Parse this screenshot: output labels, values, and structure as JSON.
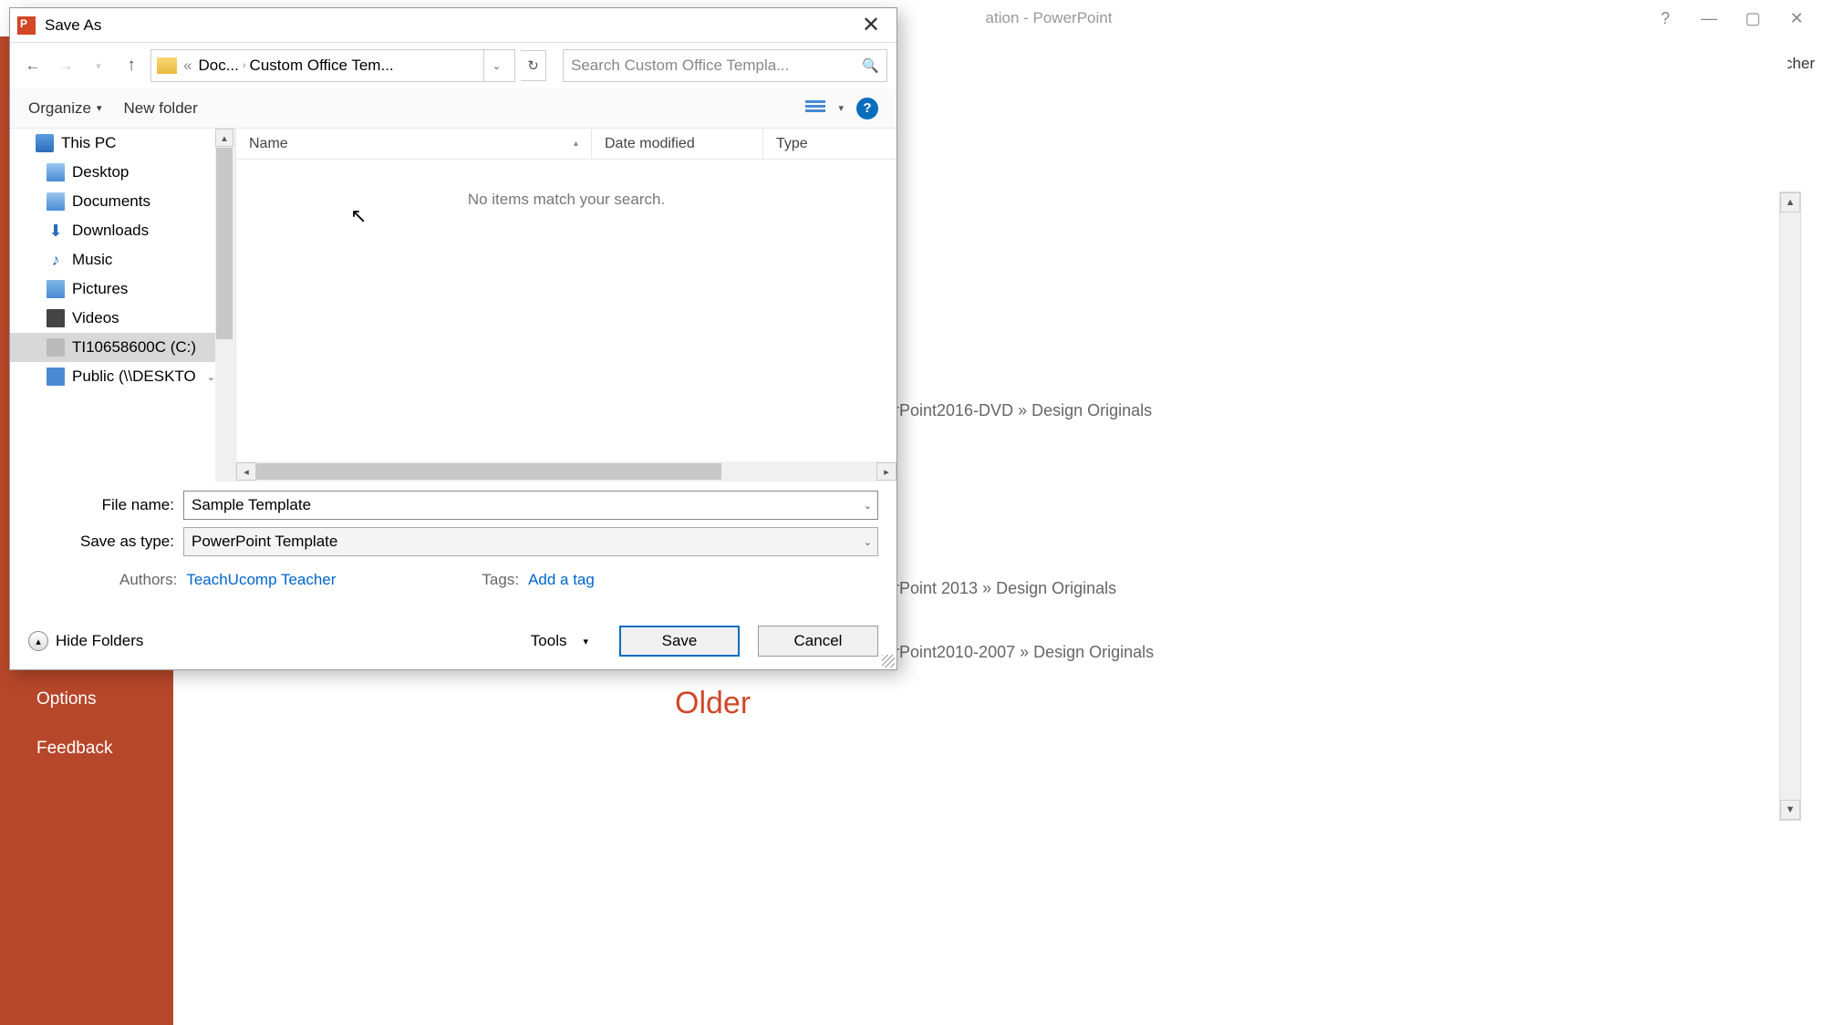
{
  "bg": {
    "title_suffix": "ation - PowerPoint",
    "user": "TeachUcomp Teacher",
    "sidebar": {
      "options": "Options",
      "feedback": "Feedback"
    },
    "lines": {
      "l1": "rPoint2016-DVD » Design Originals",
      "l2": "rPoint 2013 » Design Originals",
      "l3": "rPoint2010-2007 » Design Originals"
    },
    "older": "Older"
  },
  "dialog": {
    "title": "Save As",
    "breadcrumb": {
      "p1": "Doc...",
      "p2": "Custom Office Tem..."
    },
    "search_placeholder": "Search Custom Office Templa...",
    "toolbar": {
      "organize": "Organize",
      "new_folder": "New folder"
    },
    "columns": {
      "name": "Name",
      "date": "Date modified",
      "type": "Type"
    },
    "empty": "No items match your search.",
    "tree": {
      "this_pc": "This PC",
      "desktop": "Desktop",
      "documents": "Documents",
      "downloads": "Downloads",
      "music": "Music",
      "pictures": "Pictures",
      "videos": "Videos",
      "cdrive": "TI10658600C (C:)",
      "public": "Public (\\\\DESKTO"
    },
    "file_name_label": "File name:",
    "file_name": "Sample Template",
    "save_type_label": "Save as type:",
    "save_type": "PowerPoint Template",
    "authors_label": "Authors:",
    "authors": "TeachUcomp Teacher",
    "tags_label": "Tags:",
    "tags": "Add a tag",
    "hide_folders": "Hide Folders",
    "tools": "Tools",
    "save": "Save",
    "cancel": "Cancel"
  }
}
